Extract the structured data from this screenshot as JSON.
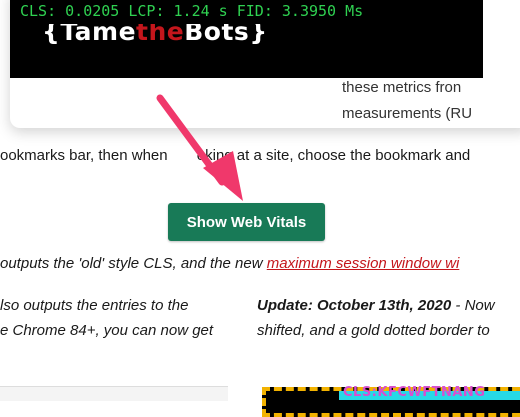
{
  "card": {
    "metrics_text": "CLS: 0.0205 LCP: 1.24 s FID: 3.3950 Ms",
    "logo_brace_open": "{",
    "logo_tame": "Tame",
    "logo_the": "the",
    "logo_bots": "Bots",
    "logo_brace_close": "}",
    "text_line_1": "these metrics fron",
    "text_line_2": "measurements (RU"
  },
  "body": {
    "instructions": "ookmarks bar, then when       oking at a site, choose the bookmark and",
    "show_button_label": "Show Web Vitals",
    "cls_text": "outputs the 'old' style CLS, and the new",
    "cls_link": "maximum session window wi",
    "left_line_1": "lso outputs the entries to the",
    "left_line_2": "e Chrome 84+, you can now get",
    "update_title": "Update: October 13th, 2020",
    "update_rest": " - Now",
    "right_line_2": "shifted, and a gold dotted border to",
    "thumb_text": "CLS:KFCWFTNANG"
  },
  "colors": {
    "button_bg": "#187a57",
    "metrics_green": "#2fd151",
    "link_red": "#c4161c",
    "arrow_pink": "#f0386b",
    "gold_border": "#f2b200"
  }
}
